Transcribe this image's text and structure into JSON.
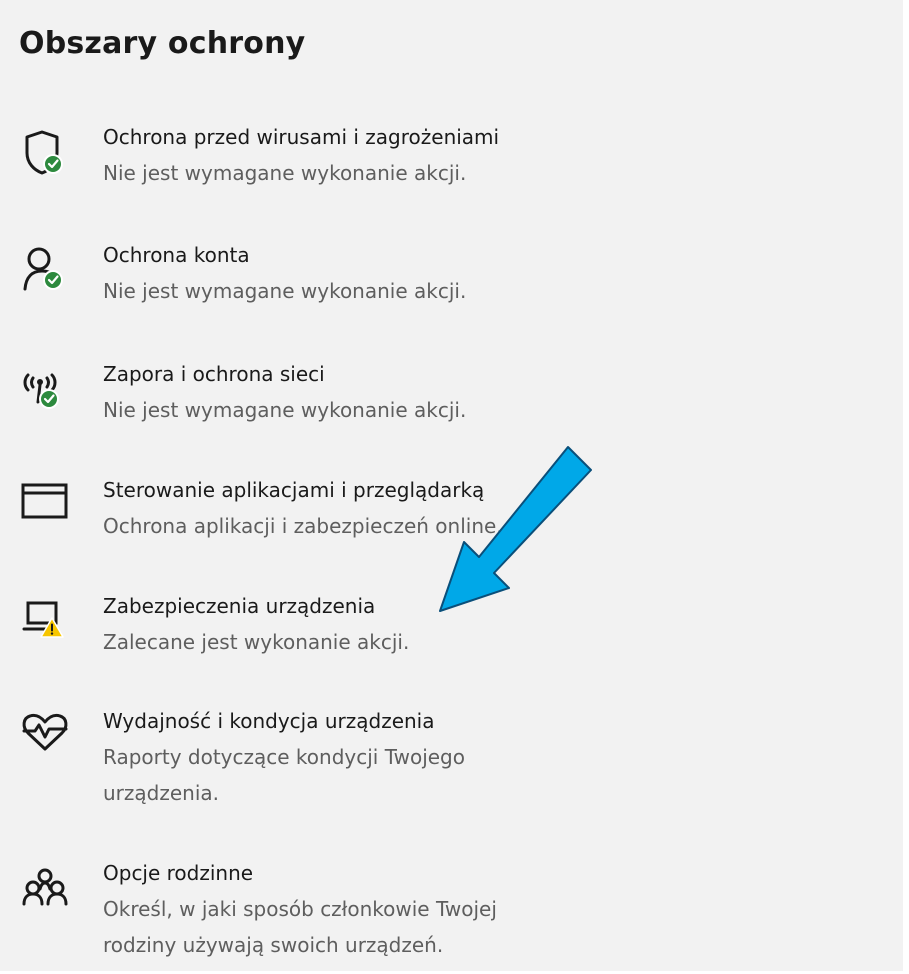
{
  "page": {
    "title": "Obszary ochrony"
  },
  "items": [
    {
      "icon": "shield-check-icon",
      "name": "Ochrona przed wirusami i zagrożeniami",
      "status": "Nie jest wymagane wykonanie akcji.",
      "badge": "ok"
    },
    {
      "icon": "account-check-icon",
      "name": "Ochrona konta",
      "status": "Nie jest wymagane wykonanie akcji.",
      "badge": "ok"
    },
    {
      "icon": "network-antenna-check-icon",
      "name": "Zapora i ochrona sieci",
      "status": "Nie jest wymagane wykonanie akcji.",
      "badge": "ok"
    },
    {
      "icon": "app-browser-window-icon",
      "name": "Sterowanie aplikacjami i przeglądarką",
      "status": "Ochrona aplikacji i zabezpieczeń online.",
      "badge": "none"
    },
    {
      "icon": "laptop-warning-icon",
      "name": "Zabezpieczenia urządzenia",
      "status": "Zalecane jest wykonanie akcji.",
      "badge": "warning"
    },
    {
      "icon": "heart-health-icon",
      "name": "Wydajność i kondycja urządzenia",
      "status": "Raporty dotyczące kondycji Twojego urządzenia.",
      "badge": "none"
    },
    {
      "icon": "family-icon",
      "name": "Opcje rodzinne",
      "status": "Określ, w jaki sposób członkowie Twojej rodziny używają swoich urządzeń.",
      "badge": "none"
    }
  ],
  "colors": {
    "panel_background": "#f2f2f2",
    "text_primary": "#1a1a1a",
    "text_secondary": "#5e5e5e",
    "ok_badge": "#2d8a3e",
    "warning_badge": "#f7c600",
    "annotation_arrow": "#00a8e8"
  }
}
